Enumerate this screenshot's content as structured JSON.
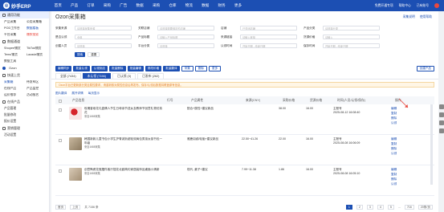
{
  "topbar": {
    "logo": "妙手ERP",
    "nav": [
      "首页",
      "产品",
      "订单",
      "采购",
      "广告",
      "数据",
      "采购",
      "仓库",
      "物流",
      "数据",
      "财务",
      "更多"
    ],
    "right": [
      "免费开通专项",
      "帮助中心",
      "已有账号"
    ]
  },
  "sidebar": {
    "group1": "通用功能",
    "pairs": [
      [
        "产品采集",
        "公用采集箱"
      ],
      [
        "POD工作台",
        "数据看板"
      ],
      [
        "平台采集",
        "爆款搜索"
      ]
    ],
    "group2": "数据通道",
    "pairs2": [
      [
        "Shopee铺货",
        "TikTok铺货"
      ],
      [
        "Temu铺货",
        "Lazada铺货"
      ],
      [
        "数据工具",
        ""
      ]
    ],
    "ozon": "Ozon",
    "group3": "快速上货",
    "items3": [
      [
        "采集箱",
        "待发布区"
      ],
      [
        "在线产品",
        "产品监控"
      ],
      [
        "运价推荐",
        "活动报名"
      ]
    ],
    "group4": "在线产品",
    "items4": [
      "产品管理",
      "批量修改",
      "报价设置"
    ],
    "group5": "营销管理",
    "items5": [
      "活动设置"
    ]
  },
  "main": {
    "title": "Ozon采集箱",
    "title_links": [
      "采集说明",
      "使用帮助"
    ],
    "filters": {
      "row1": [
        {
          "label": "采集来源",
          "placeholder": "请选择采集来源"
        },
        {
          "label": "关联店铺",
          "placeholder": "请选择需要绑定的店铺"
        },
        {
          "label": "店铺",
          "placeholder": "已关闭店铺"
        },
        {
          "label": "产品分类",
          "placeholder": "请选择分类"
        }
      ],
      "row2": [
        {
          "label": "是否认领",
          "placeholder": "全部"
        },
        {
          "label": "产品标题",
          "placeholder": "请输入产品标题"
        },
        {
          "label": "来源链接",
          "placeholder": "请输入链接"
        },
        {
          "label": "货源价格",
          "placeholder": "请输入"
        }
      ],
      "row3": [
        {
          "label": "创建人员",
          "placeholder": "请选择"
        },
        {
          "label": "平台分类",
          "placeholder": "请选择"
        },
        {
          "label": "认领时间",
          "placeholder": "开始日期  -  结束日期"
        },
        {
          "label": "保存时间",
          "placeholder": "开始日期  -  结束日期"
        }
      ],
      "search_btn": "搜索",
      "reset_btn": "重置"
    },
    "actions": [
      "编辑同步",
      "批量认领",
      "认领到店",
      "批量删除",
      "批量编辑",
      "修改价格",
      "批量翻译",
      "采集",
      "删除",
      "更多"
    ],
    "action_right": "创建产品",
    "tabs": [
      "全部 (7434)",
      "未认领 (7156)",
      "已认领 (3)",
      "已发布 (262)"
    ],
    "active_tab": 1,
    "notice": "Ozon平台已更新部分类目属性要求，请重新核对属性信息后再发布，保存/认领后数据将覆盖原有信息。",
    "toolbar2": [
      "图片翻译",
      "展开详情",
      "每页显示"
    ],
    "columns": [
      "产品信息",
      "行号",
      "产品属性",
      "来源(CNY)",
      "采购价格",
      "货源价格",
      "时间(人员/认领/保存)",
      "操作"
    ],
    "rows": [
      {
        "title": "玫瑰香皂花礼盒情人节生日母亲节送女友教师节创意礼物仿真花",
        "source": "来自1688采集",
        "price": "配合+属性+建议新品",
        "cost": "",
        "src_price": "38.00",
        "other": "16.00",
        "person": "主账号",
        "time": "2025-08-12 16:08:40",
        "ops": [
          "编辑",
          "复制",
          "删除",
          "认领"
        ]
      },
      {
        "title": "韩国新款儿童书包小学生护脊减负超轻双肩包男孩女孩书包一年级",
        "source": "来自1688采集",
        "price": "雅鹿羽绒/轮胎+建议新品",
        "cost": "22.50~41.26",
        "src_price": "22.00",
        "other": "16.00",
        "person": "主账号",
        "time": "2025-08-08 16:06:09",
        "ops": [
          "编辑",
          "复制",
          "删除",
          "认领"
        ]
      },
      {
        "title": "创意陶瓷花瓶摆件客厅插花北欧简约家居装饰品桌面小清新",
        "source": "来自1688采集",
        "price": "现代, 桌子+建议",
        "cost": "7.99~11.38",
        "src_price": "1.86",
        "other": "16.00",
        "person": "主账号",
        "time": "2025-08-08 16:05:10",
        "ops": [
          "编辑",
          "复制",
          "删除",
          "认领"
        ]
      }
    ],
    "pager": {
      "first": "首页",
      "prev": "上页",
      "total": "共 7156 条",
      "pages": [
        "1",
        "2",
        "3",
        "4",
        "5",
        "...",
        "716"
      ],
      "current": "1",
      "per_page": "20条/页"
    }
  },
  "colors": {
    "primary": "#1c4fb3",
    "accent": "#e8483e",
    "warning": "#e6862f"
  }
}
